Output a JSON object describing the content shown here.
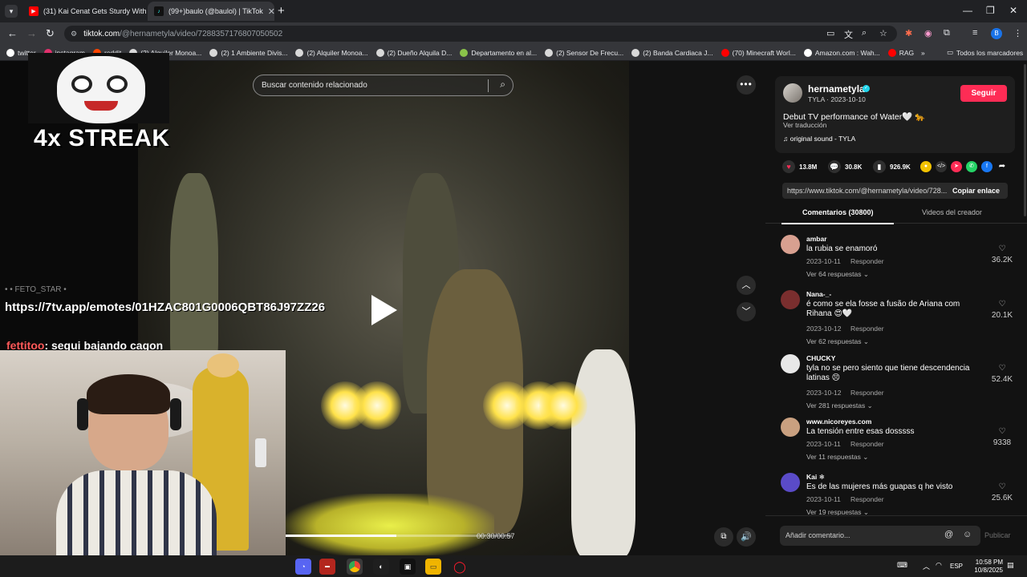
{
  "browser": {
    "tabs": [
      {
        "label": "(31) Kai Cenat Gets Sturdy With",
        "favicon_color": "#ff0000",
        "active": false
      },
      {
        "label": "(99+)baulo (@baulol) | TikTok",
        "favicon_color": "#111111",
        "active": true
      }
    ],
    "address": {
      "host": "tiktok.com",
      "path": "/@hernametyla/video/7288357176807050502"
    },
    "bookmarks": [
      {
        "label": "twitter",
        "color": "#ffffff"
      },
      {
        "label": "instagram",
        "color": "#e1306c"
      },
      {
        "label": "reddit",
        "color": "#ff4500"
      },
      {
        "label": "(2) Alquiler Monoa...",
        "color": "#d9d9d9"
      },
      {
        "label": "(2) 1 Ambiente Divis...",
        "color": "#d9d9d9"
      },
      {
        "label": "(2) Alquiler Monoa...",
        "color": "#d9d9d9"
      },
      {
        "label": "(2) Dueño Alquila D...",
        "color": "#d9d9d9"
      },
      {
        "label": "Departamento en al...",
        "color": "#8bc34a"
      },
      {
        "label": "(2) Sensor De Frecu...",
        "color": "#d9d9d9"
      },
      {
        "label": "(2) Banda Cardiaca J...",
        "color": "#d9d9d9"
      },
      {
        "label": "(70) Minecraft Worl...",
        "color": "#ff0000"
      },
      {
        "label": "Amazon.com : Wah...",
        "color": "#ffffff"
      },
      {
        "label": "RAG",
        "color": "#ff0000"
      }
    ],
    "bookmarks_more": "»",
    "all_bookmarks": "Todos los marcadores",
    "profile_initial": "B"
  },
  "player": {
    "search_placeholder": "Buscar contenido relacionado",
    "timecode": "00:30/00:57",
    "progress": 0.49
  },
  "stream_overlay": {
    "streak": "4x STREAK",
    "chat_link": "https://7tv.app/emotes/01HZAC801G0006QBT86J97ZZ26",
    "chat_cut": "• • FETO_STAR •",
    "chat_user": "fettitoo",
    "chat_message": ": segui bajando cagon"
  },
  "author": {
    "username": "hernametyla",
    "subline": "TYLA · 2023-10-10",
    "follow_label": "Seguir",
    "caption": "Debut TV performance of Water🤍 🐆",
    "translate_label": "Ver traducción",
    "sound": "original sound - TYLA"
  },
  "stats": {
    "likes": "13.8M",
    "comments": "30.8K",
    "saves": "926.9K"
  },
  "share": {
    "link": "https://www.tiktok.com/@hernametyla/video/728...",
    "copy_label": "Copiar enlace"
  },
  "panel_tabs": {
    "comments": "Comentarios (30800)",
    "creator_videos": "Videos del creador"
  },
  "comments": [
    {
      "user": "ambar",
      "text": "la rubia se enamoró",
      "date": "2023-10-11",
      "reply": "Responder",
      "likes": "36.2K",
      "more": "Ver 64 respuestas ⌄",
      "avatar_color": "#d8a090"
    },
    {
      "user": "Nana-_-",
      "text": "é como se ela fosse a fusão de Ariana com Rihana 😍🤍",
      "date": "2023-10-12",
      "reply": "Responder",
      "likes": "20.1K",
      "more": "Ver 62 respuestas ⌄",
      "avatar_color": "#7a2e2e"
    },
    {
      "user": "CHUCKY",
      "text": "tyla no se pero siento que tiene descendencia latinas 😣",
      "date": "2023-10-12",
      "reply": "Responder",
      "likes": "52.4K",
      "more": "Ver 281 respuestas ⌄",
      "avatar_color": "#e8e8e8"
    },
    {
      "user": "www.nicoreyes.com",
      "text": "La tensión entre esas dosssss",
      "date": "2023-10-11",
      "reply": "Responder",
      "likes": "9338",
      "more": "Ver 11 respuestas ⌄",
      "avatar_color": "#c9a080"
    },
    {
      "user": "Kai ❄",
      "text": "Es de las mujeres más guapas q he visto",
      "date": "2023-10-11",
      "reply": "Responder",
      "likes": "25.6K",
      "more": "Ver 19 respuestas ⌄",
      "avatar_color": "#5a4bc8"
    }
  ],
  "comment_box": {
    "placeholder": "Añadir comentario...",
    "publish": "Publicar"
  },
  "taskbar": {
    "lang": "ESP",
    "time": "10:58 PM",
    "date": "10/8/2025"
  },
  "colors": {
    "accent": "#fe2c55",
    "panel_bg": "#121212",
    "verified": "#20d5ec"
  }
}
